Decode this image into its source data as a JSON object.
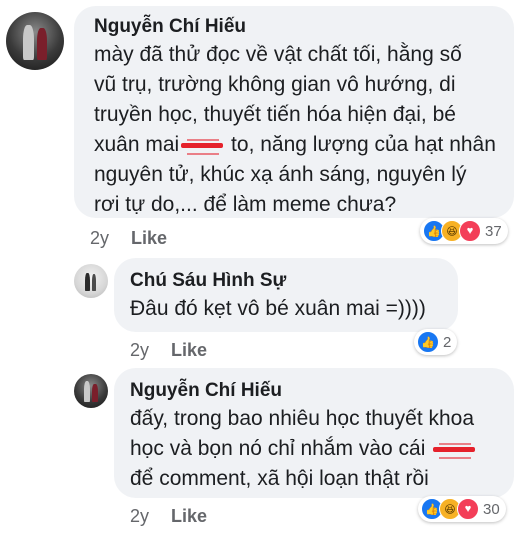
{
  "comments": [
    {
      "author": "Nguyễn Chí Hiếu",
      "lines": [
        "mày đã thử đọc về vật chất tối, hằng số",
        "vũ trụ, trường không gian vô hướng, di",
        "truyền học, thuyết tiến hóa hiện đại, bé",
        "xuân mai",
        " to, năng lượng của hạt nhân",
        "nguyên tử, khúc xạ ánh sáng, nguyên lý",
        "rơi tự do,... để làm meme chưa?"
      ],
      "time": "2y",
      "like_label": "Like",
      "reactions": {
        "icons": [
          "like-icon",
          "haha-icon",
          "love-icon"
        ],
        "count": "37"
      }
    },
    {
      "author": "Chú Sáu Hình Sự",
      "lines": [
        "Đâu đó kẹt vô bé xuân mai =))))"
      ],
      "time": "2y",
      "like_label": "Like",
      "reactions": {
        "icons": [
          "like-icon"
        ],
        "count": "2"
      }
    },
    {
      "author": "Nguyễn Chí Hiếu",
      "lines": [
        "đấy, trong bao nhiêu học thuyết khoa",
        "học và bọn nó chỉ nhắm vào cái",
        "để comment, xã hội loạn thật rồi"
      ],
      "time": "2y",
      "like_label": "Like",
      "reactions": {
        "icons": [
          "like-icon",
          "haha-icon",
          "love-icon"
        ],
        "count": "30"
      }
    }
  ],
  "colors": {
    "bubble": "#f0f2f5",
    "censor": "#e5212b",
    "like": "#1877f2",
    "haha": "#f7b125",
    "love": "#f33e58"
  }
}
